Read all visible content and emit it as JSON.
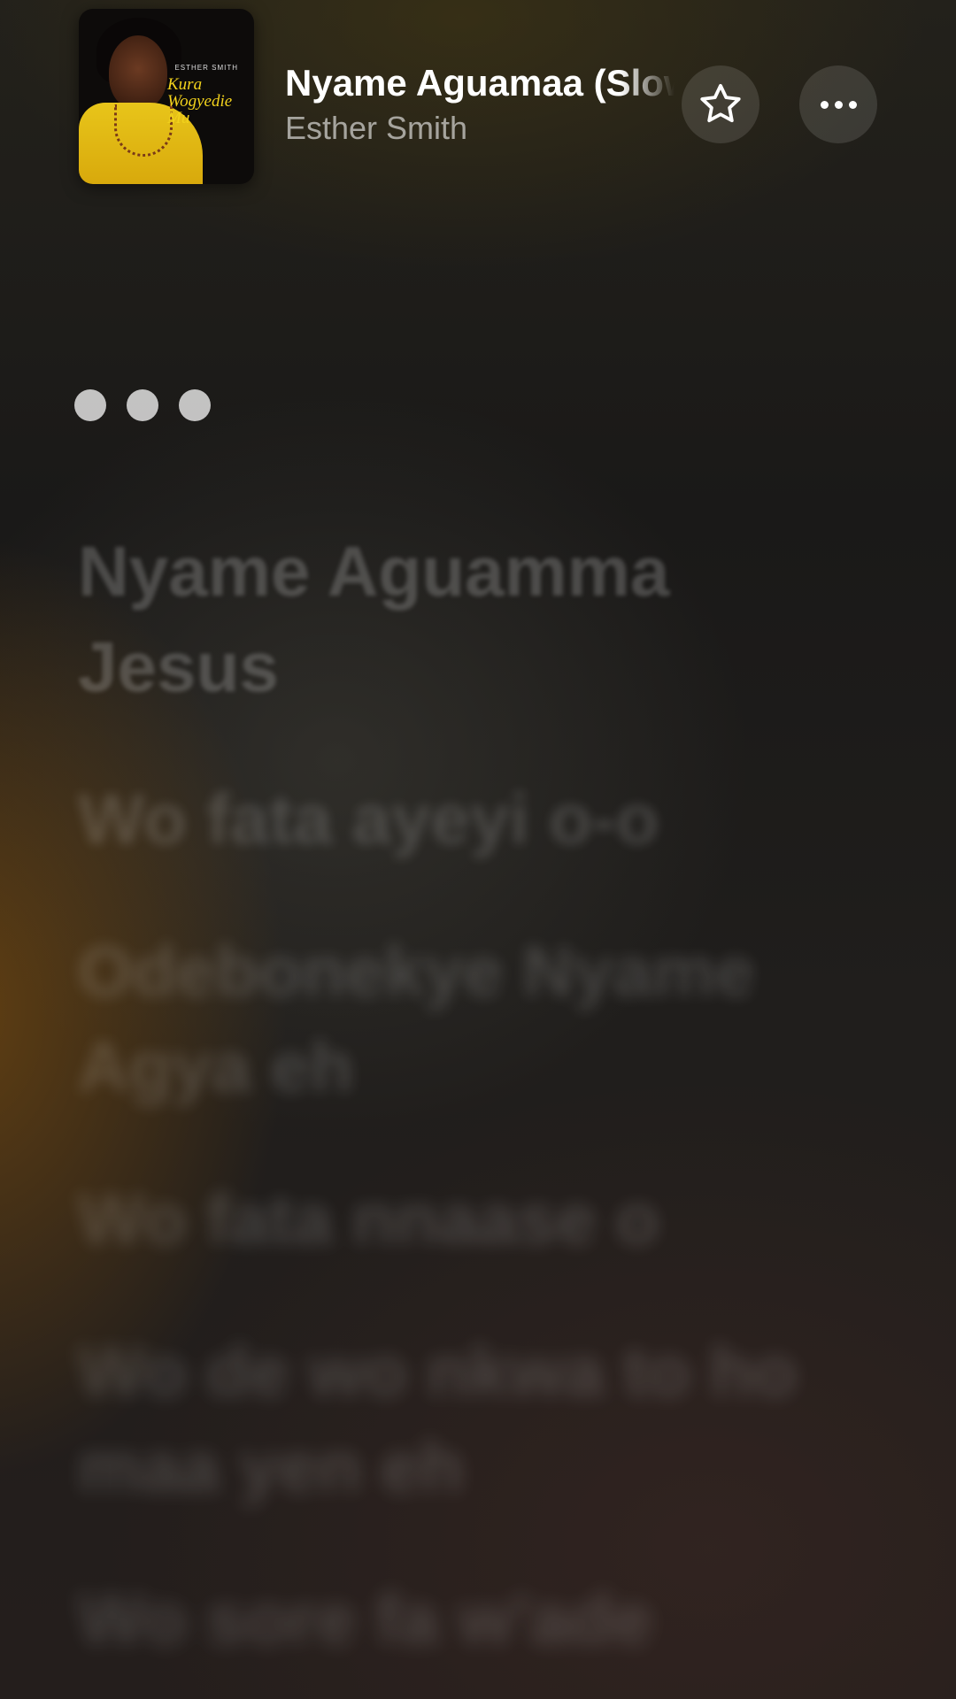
{
  "now_playing": {
    "title": "Nyame Aguamaa (Slow)",
    "artist": "Esther Smith",
    "artwork": {
      "artist_label": "ESTHER SMITH",
      "album_text": "Kura Wogyedie Mu"
    }
  },
  "controls": {
    "favorite_icon": "star-outline-icon",
    "more_icon": "ellipsis-icon"
  },
  "lyrics": [
    "Nyame Aguamma Jesus",
    "Wo fata ayeyi o-o",
    "Odebonekye Nyame Agya eh",
    "Wo fata nnaase o",
    "Wo de wo nkwa to ho maa yen eh",
    "Wo sore fa w'ade"
  ]
}
